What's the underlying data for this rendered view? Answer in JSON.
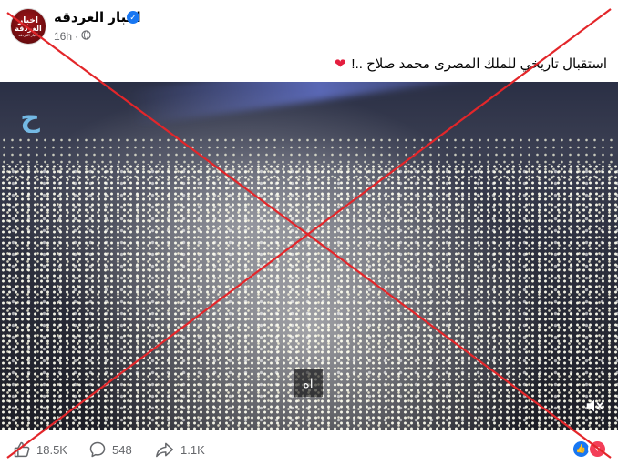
{
  "post": {
    "page_name": "اخبار الغردقه",
    "avatar_text": [
      "اخبار",
      "الغردقة",
      "أخبار الغردقة"
    ],
    "time": "16h",
    "separator": "·",
    "text": "استقبال تاريخي للملك المصرى محمد صلاح ..!"
  },
  "media": {
    "subtitle": "اه",
    "tag_logo": "ح"
  },
  "actions": {
    "likes": "18.5K",
    "comments": "548",
    "shares": "1.1K"
  },
  "colors": {
    "accent": "#1877f2",
    "love": "#f33e58",
    "cross": "#e3262a"
  }
}
